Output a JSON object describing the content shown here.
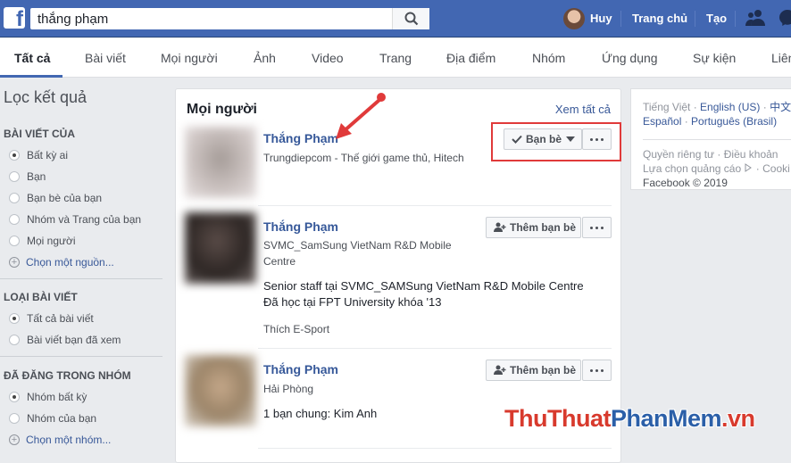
{
  "topbar": {
    "logo": "f",
    "search_value": "thắng phạm",
    "user_name": "Huy",
    "home_label": "Trang chủ",
    "create_label": "Tạo"
  },
  "tabs": [
    "Tất cả",
    "Bài viết",
    "Mọi người",
    "Ảnh",
    "Video",
    "Trang",
    "Địa điểm",
    "Nhóm",
    "Ứng dụng",
    "Sự kiện",
    "Liên"
  ],
  "filters": {
    "title": "Lọc kết quả",
    "sections": [
      {
        "heading": "BÀI VIẾT CỦA",
        "options": [
          "Bất kỳ ai",
          "Bạn",
          "Bạn bè của bạn",
          "Nhóm và Trang của bạn",
          "Mọi người"
        ],
        "selected": 0,
        "link": "Chọn một nguồn..."
      },
      {
        "heading": "LOẠI BÀI VIẾT",
        "options": [
          "Tất cả bài viết",
          "Bài viết bạn đã xem"
        ],
        "selected": 0
      },
      {
        "heading": "ĐÃ ĐĂNG TRONG NHÓM",
        "options": [
          "Nhóm bất kỳ",
          "Nhóm của bạn"
        ],
        "selected": 0,
        "link": "Chọn một nhóm..."
      }
    ]
  },
  "results": {
    "title": "Mọi người",
    "see_all": "Xem tất cả",
    "people": [
      {
        "name": "Thắng Phạm",
        "lines": [
          "Trungdiepcom - Thế giới game thủ, Hitech"
        ],
        "button": "Bạn bè"
      },
      {
        "name": "Thắng Phạm",
        "lines": [
          "SVMC_SamSung VietNam R&D Mobile",
          "Centre"
        ],
        "bio": [
          "Senior staff tại SVMC_SAMSung VietNam R&D Mobile Centre",
          "Đã học tại FPT University khóa '13"
        ],
        "likes": "Thích E-Sport",
        "button": "Thêm bạn bè"
      },
      {
        "name": "Thắng Phạm",
        "lines": [
          "Hải Phòng"
        ],
        "bio": [
          "1 bạn chung: Kim Anh"
        ],
        "button": "Thêm bạn bè"
      }
    ]
  },
  "footer": {
    "lang_current": "Tiếng Việt",
    "langs": [
      "English (US)",
      "中文",
      "Español",
      "Português (Brasil)"
    ],
    "links": [
      "Quyền riêng tư",
      "Điều khoản",
      "Lựa chọn quảng cáo",
      "Cooki"
    ],
    "copyright": "Facebook © 2019"
  },
  "watermark": {
    "part1": "ThuThuat",
    "part2": "PhanMem",
    "part3": ".vn"
  },
  "colors": {
    "brand": "#4267b2",
    "link": "#385898",
    "highlight": "#e03a3a"
  }
}
